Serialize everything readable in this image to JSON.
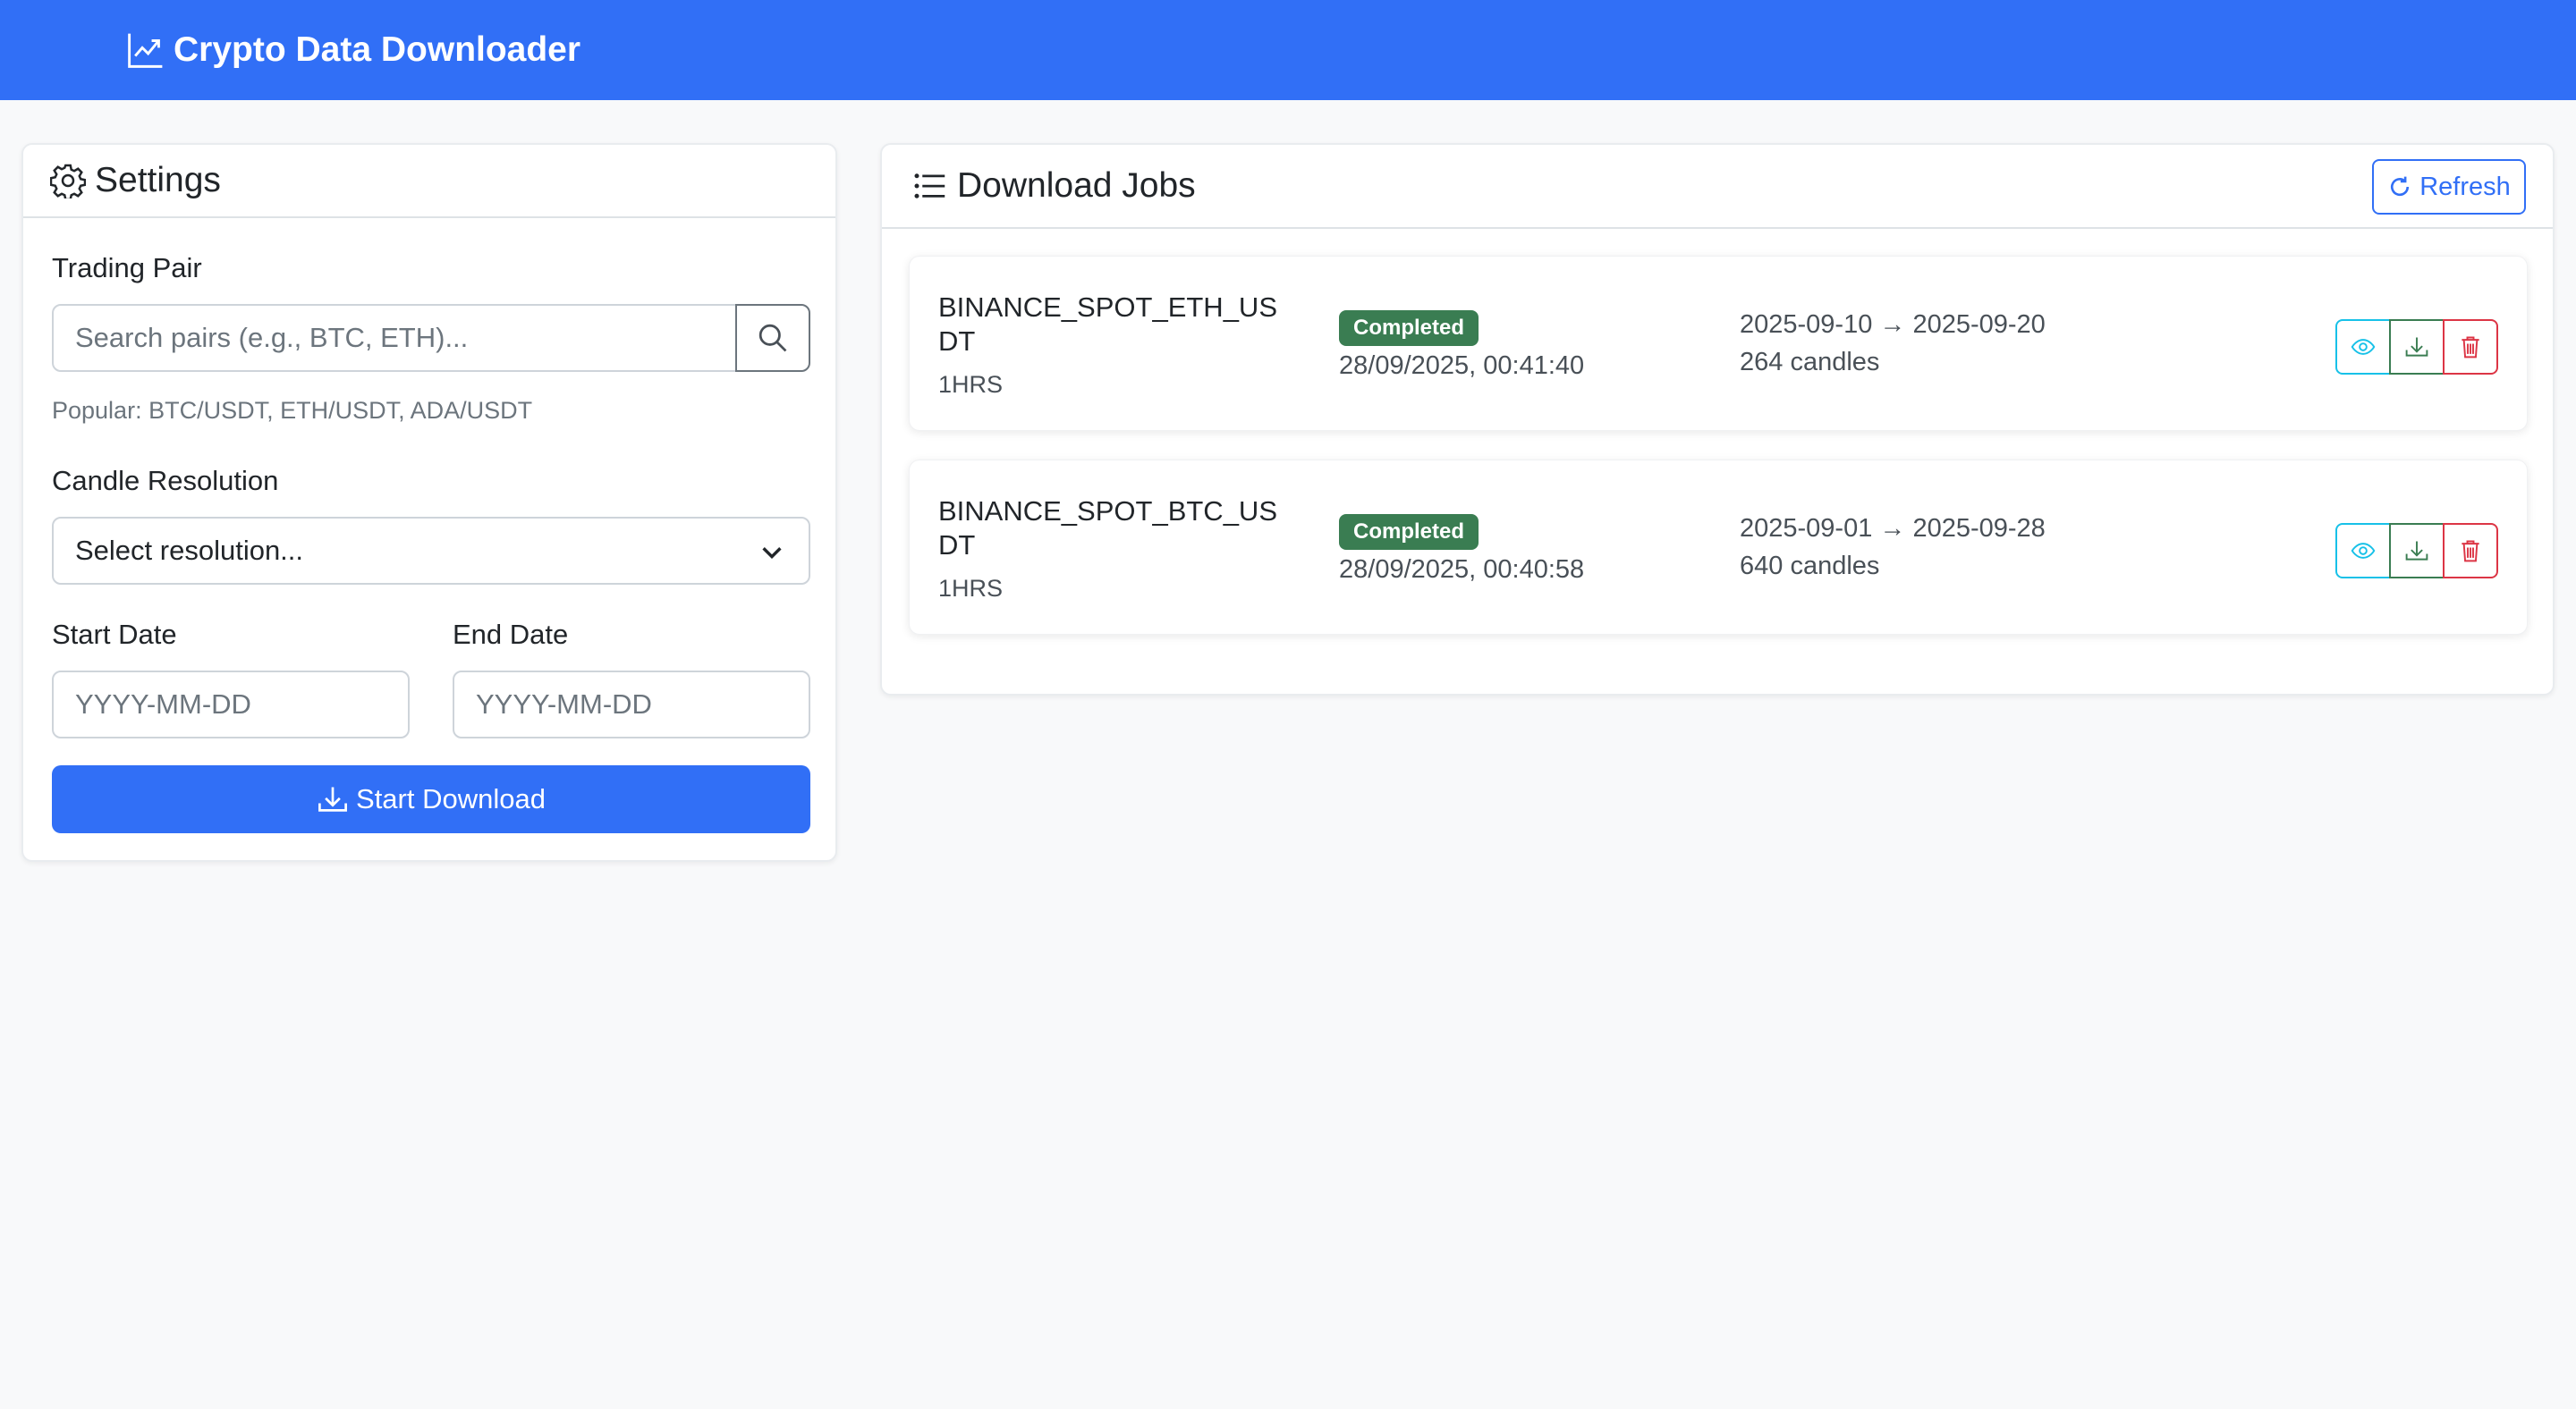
{
  "app": {
    "title": "Crypto Data Downloader",
    "accent_color": "#316ff6"
  },
  "settings": {
    "title": "Settings",
    "trading_pair_label": "Trading Pair",
    "search_placeholder": "Search pairs (e.g., BTC, ETH)...",
    "search_icon": "search-icon",
    "popular_hint": "Popular: BTC/USDT, ETH/USDT, ADA/USDT",
    "resolution_label": "Candle Resolution",
    "resolution_selected": "Select resolution...",
    "start_date_label": "Start Date",
    "start_date_placeholder": "YYYY-MM-DD",
    "end_date_label": "End Date",
    "end_date_placeholder": "YYYY-MM-DD",
    "start_download_label": "Start Download"
  },
  "jobs": {
    "title": "Download Jobs",
    "refresh_label": "Refresh",
    "items": [
      {
        "name": "BINANCE_SPOT_ETH_USDT",
        "resolution": "1HRS",
        "status": "Completed",
        "timestamp": "28/09/2025, 00:41:40",
        "range": "2025-09-10 → 2025-09-20",
        "candles": "264 candles"
      },
      {
        "name": "BINANCE_SPOT_BTC_USDT",
        "resolution": "1HRS",
        "status": "Completed",
        "timestamp": "28/09/2025, 00:40:58",
        "range": "2025-09-01 → 2025-09-28",
        "candles": "640 candles"
      }
    ],
    "status_color": "#3a7d52",
    "view_color": "#17c1e8",
    "delete_color": "#dc3545"
  }
}
